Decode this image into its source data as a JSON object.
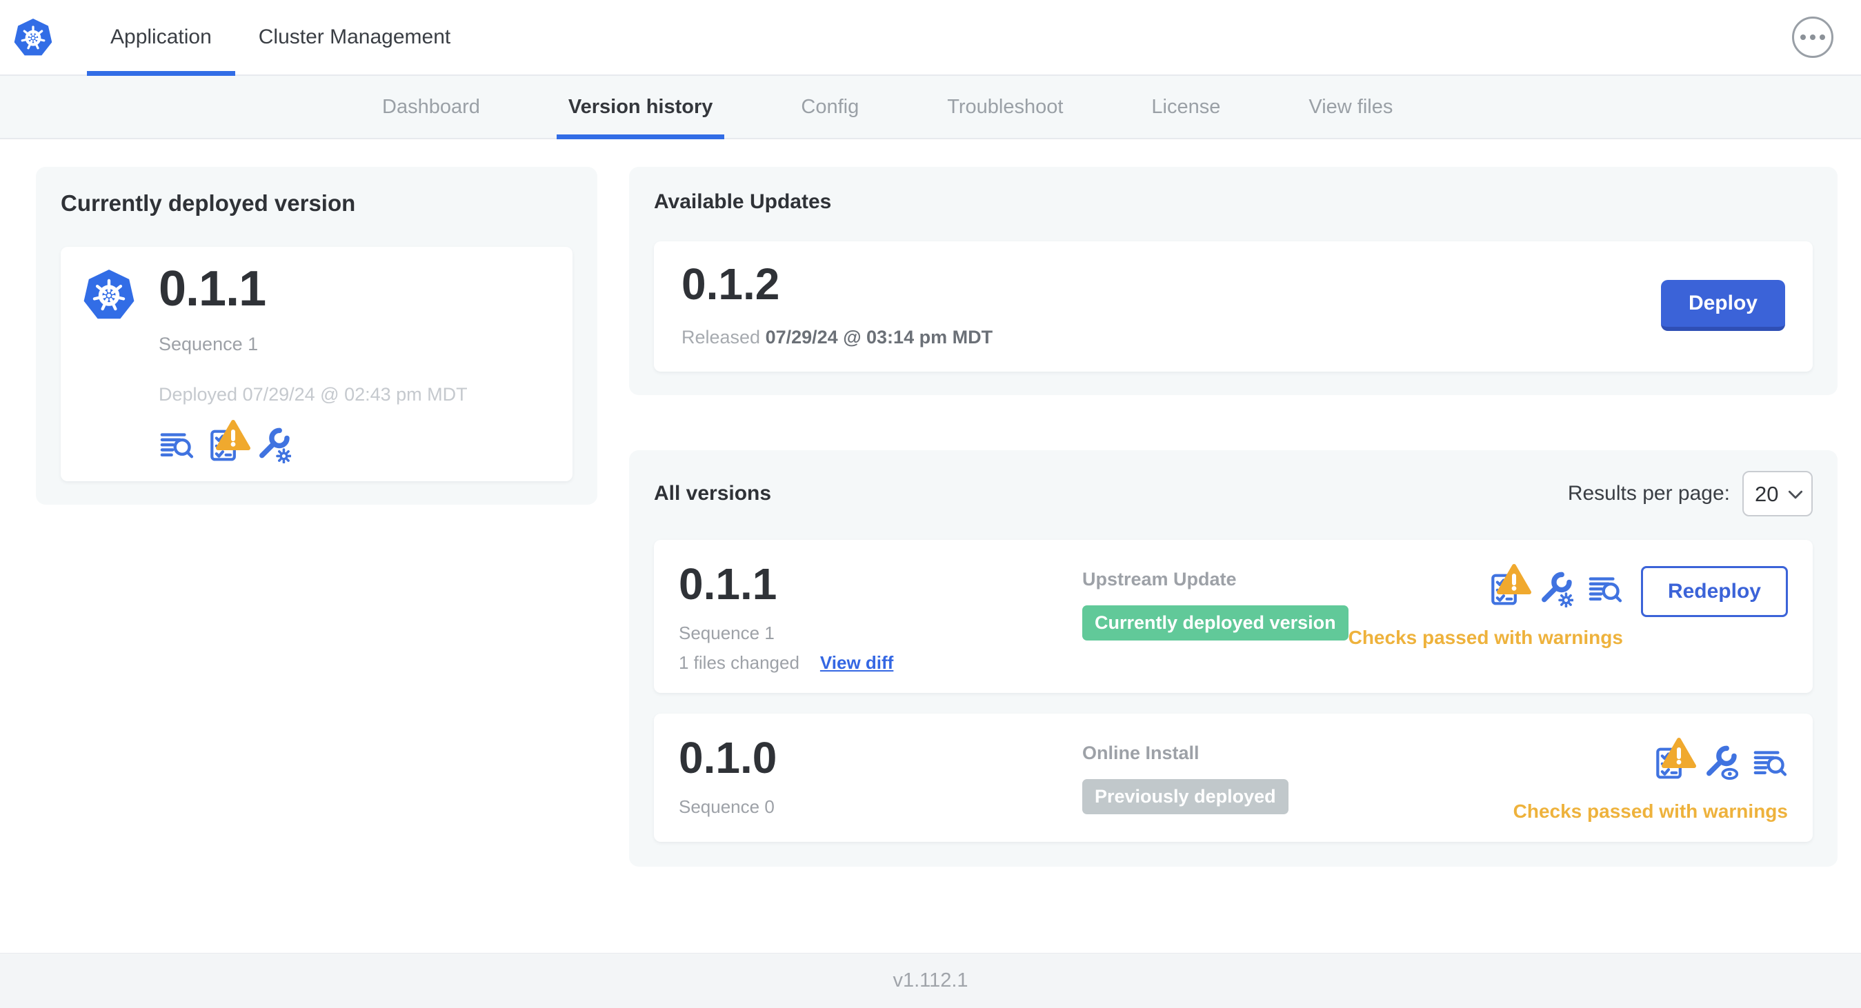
{
  "header": {
    "tabs": {
      "application": "Application",
      "cluster_management": "Cluster Management"
    }
  },
  "subnav": {
    "items": [
      {
        "label": "Dashboard"
      },
      {
        "label": "Version history"
      },
      {
        "label": "Config"
      },
      {
        "label": "Troubleshoot"
      },
      {
        "label": "License"
      },
      {
        "label": "View files"
      }
    ],
    "active": "Version history"
  },
  "currently_deployed": {
    "title": "Currently deployed version",
    "version": "0.1.1",
    "sequence": "Sequence 1",
    "deployed_at": "Deployed 07/29/24 @ 02:43 pm MDT"
  },
  "available_updates": {
    "title": "Available Updates",
    "version": "0.1.2",
    "released_label": "Released",
    "released_at": "07/29/24 @ 03:14 pm MDT",
    "deploy_button": "Deploy"
  },
  "all_versions": {
    "title": "All versions",
    "results_per_page_label": "Results per page:",
    "results_per_page": "20",
    "rows": [
      {
        "version": "0.1.1",
        "sequence": "Sequence 1",
        "files_changed": "1 files changed",
        "view_diff_link": "View diff",
        "source": "Upstream Update",
        "badge": "Currently deployed version",
        "status": "Checks passed with warnings",
        "action_button": "Redeploy"
      },
      {
        "version": "0.1.0",
        "sequence": "Sequence 0",
        "source": "Online Install",
        "badge": "Previously deployed",
        "status": "Checks passed with warnings"
      }
    ]
  },
  "footer": {
    "app_version": "v1.112.1"
  },
  "icons": {
    "kubernetes-logo": "blue heptagon with white ship wheel",
    "more-options-icon": "circled horizontal ellipsis",
    "deploy-logs-icon": "text lines with magnifying glass",
    "preflight-checks-icon": "checklist with amber warning triangle",
    "edit-config-icon": "wrench with gear",
    "view-config-icon": "wrench with eye",
    "chevron-down-icon": "select dropdown chevron"
  },
  "colors": {
    "accent_blue": "#326de6",
    "button_blue": "#3b63d8",
    "icon_blue": "#4073e0",
    "link_blue": "#3467e3",
    "badge_green": "#61c999",
    "badge_gray": "#c1c8cb",
    "warning_amber": "#eeb23c",
    "panel_bg": "#f5f8f9"
  }
}
